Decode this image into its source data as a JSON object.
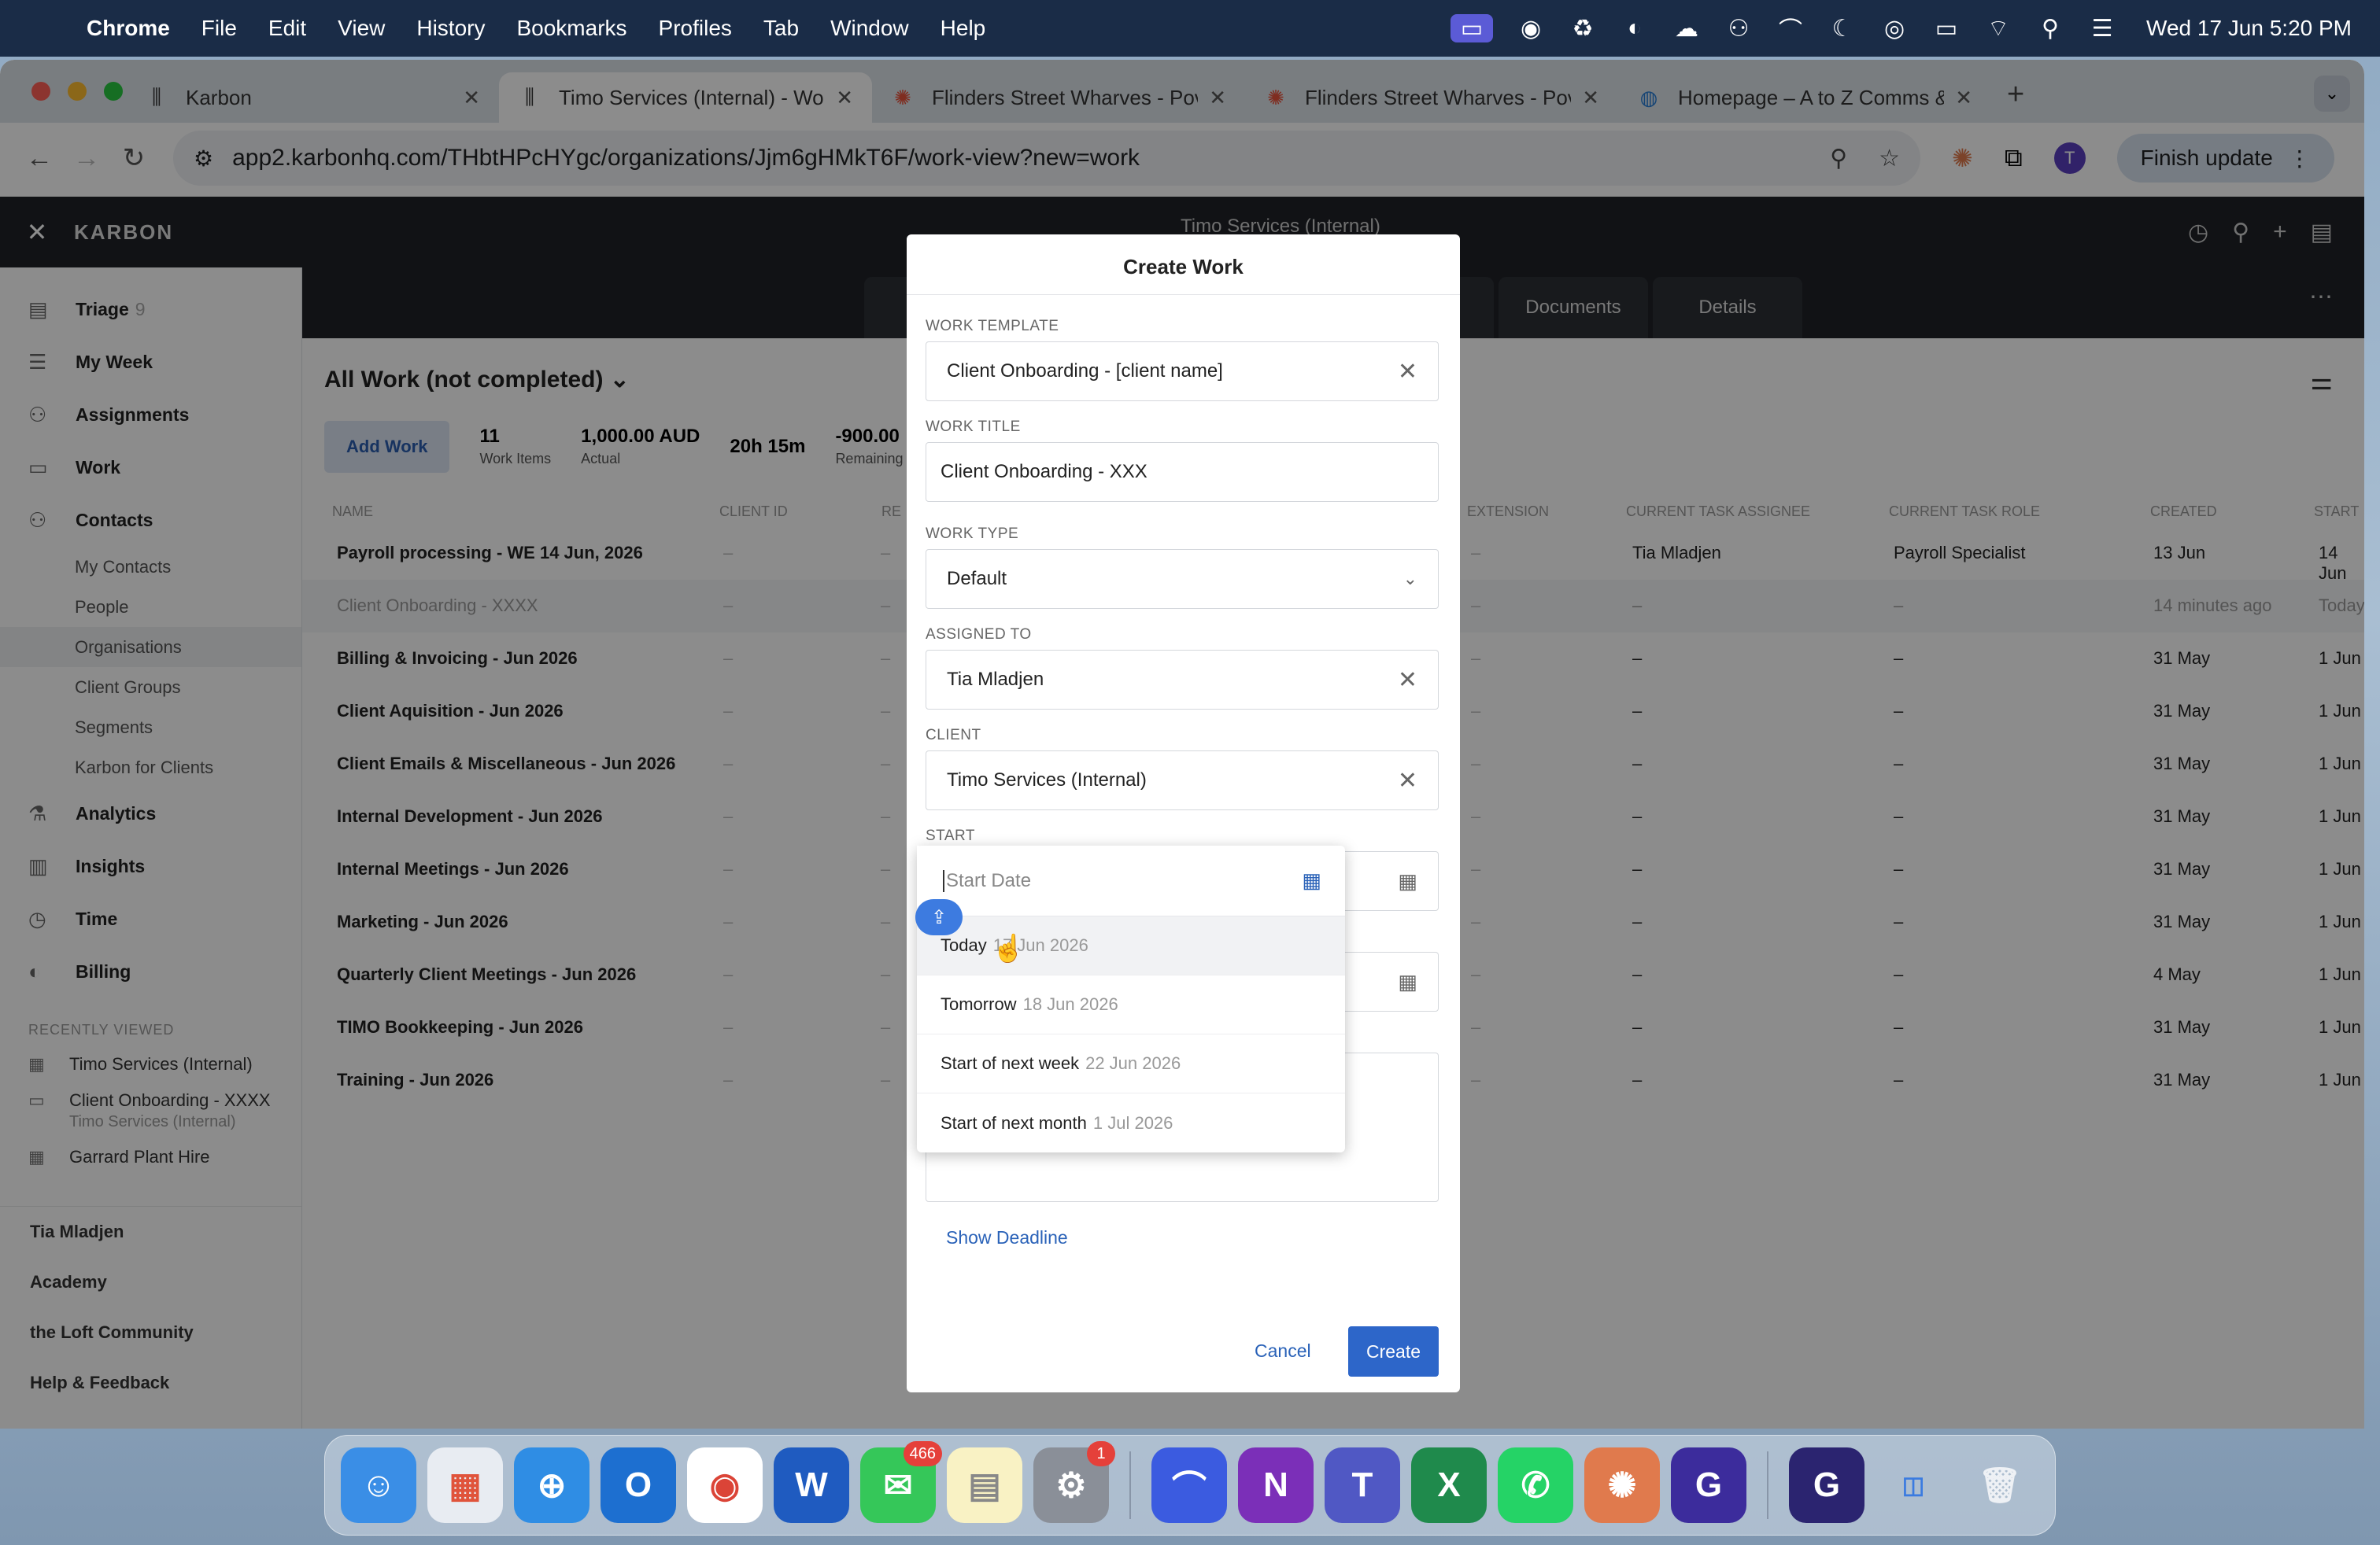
{
  "menubar": {
    "app": "Chrome",
    "items": [
      "File",
      "Edit",
      "View",
      "History",
      "Bookmarks",
      "Profiles",
      "Tab",
      "Window",
      "Help"
    ],
    "clock": "Wed 17 Jun  5:20 PM"
  },
  "browser": {
    "tabs": [
      {
        "title": "Karbon"
      },
      {
        "title": "Timo Services (Internal) - Wo"
      },
      {
        "title": "Flinders Street Wharves - Pov"
      },
      {
        "title": "Flinders Street Wharves - Pov"
      },
      {
        "title": "Homepage – A to Z Comms &"
      }
    ],
    "url": "app2.karbonhq.com/THbtHPcHYgc/organizations/Jjm6gHMkT6F/work-view?new=work",
    "avatar_letter": "T",
    "finish_update": "Finish update"
  },
  "app": {
    "brand": "KARBON",
    "org_title": "Timo Services (Internal)",
    "nav": [
      {
        "label": "Triage",
        "count": "9",
        "icon": "triage-icon"
      },
      {
        "label": "My Week",
        "icon": "list-icon"
      },
      {
        "label": "Assignments",
        "icon": "assignments-icon"
      },
      {
        "label": "Work",
        "icon": "work-icon"
      },
      {
        "label": "Contacts",
        "icon": "contacts-icon"
      }
    ],
    "contacts_sub": [
      "My Contacts",
      "People",
      "Organisations",
      "Client Groups",
      "Segments",
      "Karbon for Clients"
    ],
    "nav2": [
      {
        "label": "Analytics",
        "icon": "analytics-icon"
      },
      {
        "label": "Insights",
        "icon": "insights-icon"
      },
      {
        "label": "Time",
        "icon": "time-icon"
      },
      {
        "label": "Billing",
        "icon": "billing-icon"
      }
    ],
    "recently_viewed_label": "RECENTLY VIEWED",
    "recent": [
      {
        "title": "Timo Services (Internal)",
        "sub": ""
      },
      {
        "title": "Client Onboarding - XXXX",
        "sub": "Timo Services (Internal)"
      },
      {
        "title": "Garrard Plant Hire",
        "sub": ""
      }
    ],
    "footer": [
      "Tia Mladjen",
      "Academy",
      "the Loft Community",
      "Help & Feedback"
    ],
    "subtabs": [
      "Documents",
      "Details"
    ],
    "view_title": "All Work (not completed)",
    "add_work": "Add Work",
    "stats": [
      {
        "value": "11",
        "label": "Work Items"
      },
      {
        "value": "1,000.00 AUD",
        "label": "Actual"
      },
      {
        "value": "20h 15m",
        "label": ""
      },
      {
        "value": "-900.00",
        "label": "Remaining"
      }
    ],
    "columns": [
      "NAME",
      "CLIENT ID",
      "RE",
      "EXTENSION",
      "CURRENT TASK ASSIGNEE",
      "CURRENT TASK ROLE",
      "CREATED",
      "START"
    ],
    "rows": [
      {
        "name": "Payroll processing - WE 14 Jun, 2026",
        "assignee": "Tia Mladjen",
        "role": "Payroll Specialist",
        "created": "13 Jun",
        "start": "14 Jun"
      },
      {
        "name": "Client Onboarding - XXXX",
        "assignee": "–",
        "role": "–",
        "created": "14 minutes ago",
        "start": "Today"
      },
      {
        "name": "Billing & Invoicing - Jun 2026",
        "assignee": "–",
        "role": "–",
        "created": "31 May",
        "start": "1 Jun"
      },
      {
        "name": "Client Aquisition - Jun 2026",
        "assignee": "–",
        "role": "–",
        "created": "31 May",
        "start": "1 Jun"
      },
      {
        "name": "Client Emails & Miscellaneous - Jun 2026",
        "assignee": "–",
        "role": "–",
        "created": "31 May",
        "start": "1 Jun"
      },
      {
        "name": "Internal Development - Jun 2026",
        "assignee": "–",
        "role": "–",
        "created": "31 May",
        "start": "1 Jun"
      },
      {
        "name": "Internal Meetings - Jun 2026",
        "assignee": "–",
        "role": "–",
        "created": "31 May",
        "start": "1 Jun"
      },
      {
        "name": "Marketing - Jun 2026",
        "assignee": "–",
        "role": "–",
        "created": "31 May",
        "start": "1 Jun"
      },
      {
        "name": "Quarterly Client Meetings - Jun 2026",
        "assignee": "–",
        "role": "–",
        "created": "4 May",
        "start": "1 Jun"
      },
      {
        "name": "TIMO Bookkeeping - Jun 2026",
        "assignee": "–",
        "role": "–",
        "created": "31 May",
        "start": "1 Jun"
      },
      {
        "name": "Training - Jun 2026",
        "assignee": "–",
        "role": "–",
        "created": "31 May",
        "start": "1 Jun"
      }
    ]
  },
  "modal": {
    "title": "Create Work",
    "template_label": "WORK TEMPLATE",
    "template_value": "Client Onboarding - [client name]",
    "title_label": "WORK TITLE",
    "title_value": "Client Onboarding - XXX",
    "type_label": "WORK TYPE",
    "type_value": "Default",
    "assigned_label": "ASSIGNED TO",
    "assigned_value": "Tia Mladjen",
    "client_label": "CLIENT",
    "client_value": "Timo Services (Internal)",
    "start_label": "START",
    "show_deadline": "Show Deadline",
    "cancel": "Cancel",
    "create": "Create"
  },
  "datepicker": {
    "placeholder": "Start Date",
    "options": [
      {
        "label": "Today",
        "date": "17 Jun 2026"
      },
      {
        "label": "Tomorrow",
        "date": "18 Jun 2026"
      },
      {
        "label": "Start of next week",
        "date": "22 Jun 2026"
      },
      {
        "label": "Start of next month",
        "date": "1 Jul 2026"
      }
    ]
  },
  "dock": {
    "apps": [
      "Finder",
      "Launchpad",
      "Safari",
      "Outlook",
      "Chrome",
      "Word",
      "Messages",
      "Notes",
      "System Settings",
      "Copilot",
      "OneNote",
      "Teams",
      "Excel",
      "WhatsApp",
      "Claude",
      "Grammarly",
      "Grammarly Desktop",
      "Trash"
    ],
    "messages_badge": "466",
    "settings_badge": "1"
  }
}
